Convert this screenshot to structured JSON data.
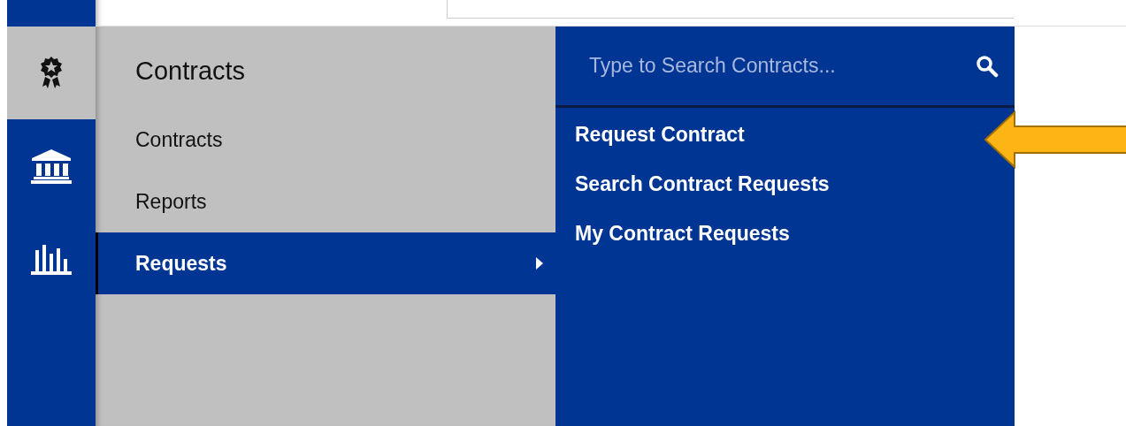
{
  "rail": [
    {
      "selected": true
    },
    {
      "selected": false
    },
    {
      "selected": false
    }
  ],
  "menu": {
    "title": "Contracts",
    "items": [
      {
        "label": "Contracts",
        "selected": false,
        "submenu": false
      },
      {
        "label": "Reports",
        "selected": false,
        "submenu": false
      },
      {
        "label": "Requests",
        "selected": true,
        "submenu": true
      }
    ]
  },
  "submenu": {
    "search": {
      "placeholder": "Type to Search Contracts..."
    },
    "items": [
      {
        "label": "Request Contract",
        "highlighted": true
      },
      {
        "label": "Search Contract Requests",
        "highlighted": false
      },
      {
        "label": "My Contract Requests",
        "highlighted": false
      }
    ]
  }
}
